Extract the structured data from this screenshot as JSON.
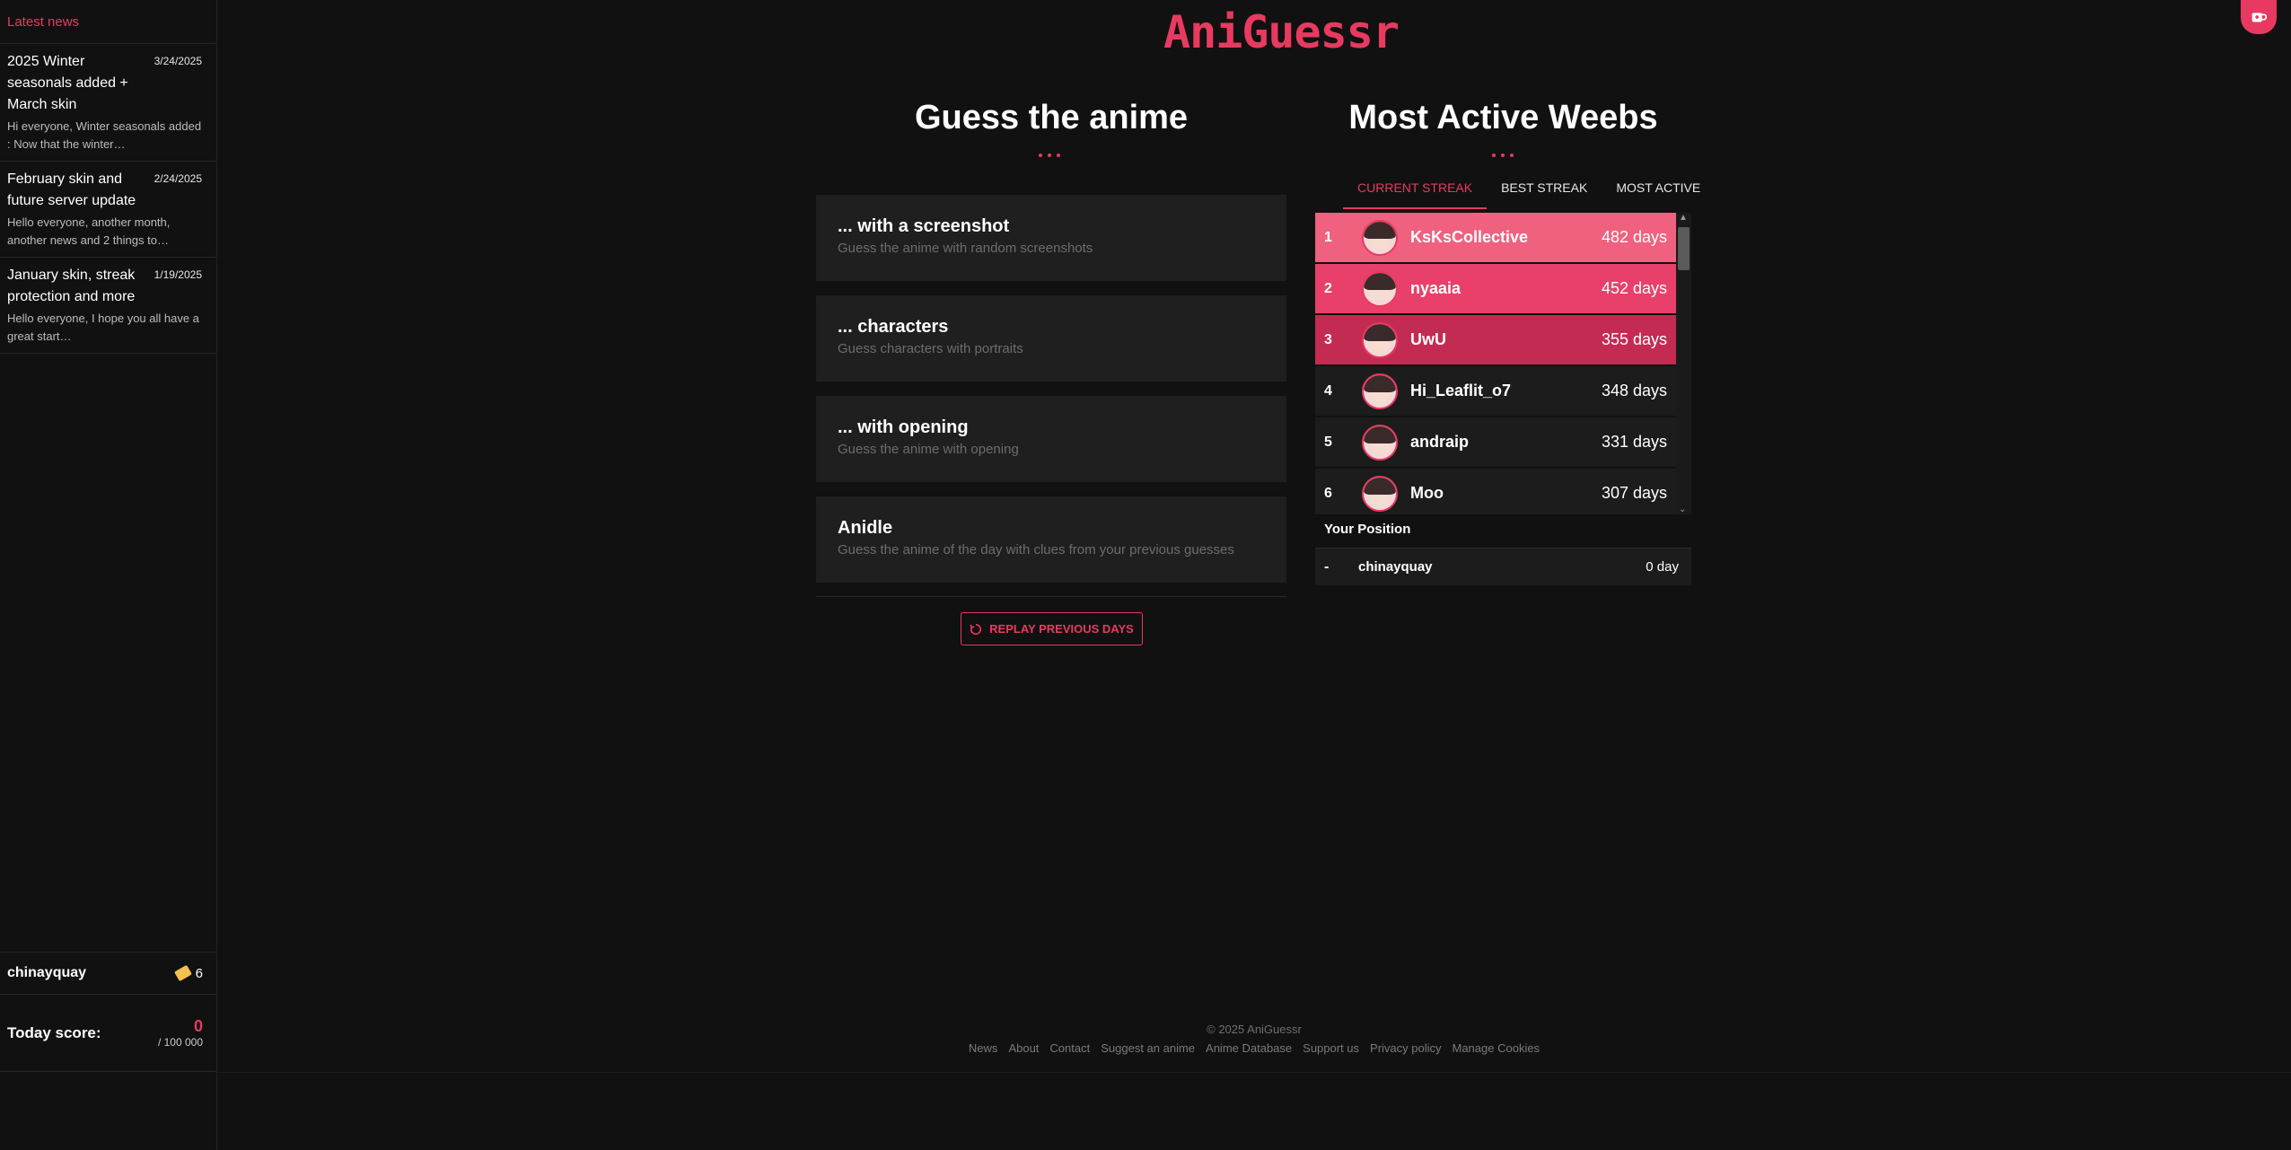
{
  "sidebar": {
    "heading": "Latest news",
    "news": [
      {
        "title": "2025 Winter seasonals added + March skin",
        "date": "3/24/2025",
        "excerpt": "Hi everyone, Winter seasonals added : Now that the winter…"
      },
      {
        "title": "February skin and future server update",
        "date": "2/24/2025",
        "excerpt": "Hello everyone, another month, another news and 2 things to…"
      },
      {
        "title": "January skin, streak protection and more",
        "date": "1/19/2025",
        "excerpt": "Hello everyone, I hope you all have a great start…"
      }
    ],
    "user": {
      "name": "chinayquay",
      "tickets": "6"
    },
    "score": {
      "label": "Today score:",
      "current": "0",
      "max": "/ 100 000"
    }
  },
  "header": {
    "logo": "AniGuessr"
  },
  "guess": {
    "title": "Guess the anime",
    "modes": [
      {
        "title": "... with a screenshot",
        "desc": "Guess the anime with random screenshots"
      },
      {
        "title": "... characters",
        "desc": "Guess characters with portraits"
      },
      {
        "title": "... with opening",
        "desc": "Guess the anime with opening"
      },
      {
        "title": "Anidle",
        "desc": "Guess the anime of the day with clues from your previous guesses"
      }
    ],
    "replay_label": "REPLAY PREVIOUS DAYS"
  },
  "leaderboard": {
    "title": "Most Active Weebs",
    "tabs": [
      "CURRENT STREAK",
      "BEST STREAK",
      "MOST ACTIVE"
    ],
    "rows": [
      {
        "rank": "1",
        "name": "KsKsCollective",
        "days": "482 days",
        "color": "#f0617f"
      },
      {
        "rank": "2",
        "name": "nyaaia",
        "days": "452 days",
        "color": "#e8406a"
      },
      {
        "rank": "3",
        "name": "UwU",
        "days": "355 days",
        "color": "#c42b52"
      },
      {
        "rank": "4",
        "name": "Hi_Leaflit_o7",
        "days": "348 days",
        "color": "#1c1c1c"
      },
      {
        "rank": "5",
        "name": "andraip",
        "days": "331 days",
        "color": "#1c1c1c"
      },
      {
        "rank": "6",
        "name": "Moo",
        "days": "307 days",
        "color": "#1c1c1c"
      }
    ],
    "your_position_label": "Your Position",
    "you": {
      "rank": "-",
      "name": "chinayquay",
      "days": "0 day"
    }
  },
  "footer": {
    "copyright": "© 2025 AniGuessr",
    "links": [
      "News",
      "About",
      "Contact",
      "Suggest an anime",
      "Anime Database",
      "Support us",
      "Privacy policy",
      "Manage Cookies"
    ]
  },
  "colors": {
    "accent": "#e83a60",
    "background": "#111111",
    "card": "#1f1f1f"
  }
}
